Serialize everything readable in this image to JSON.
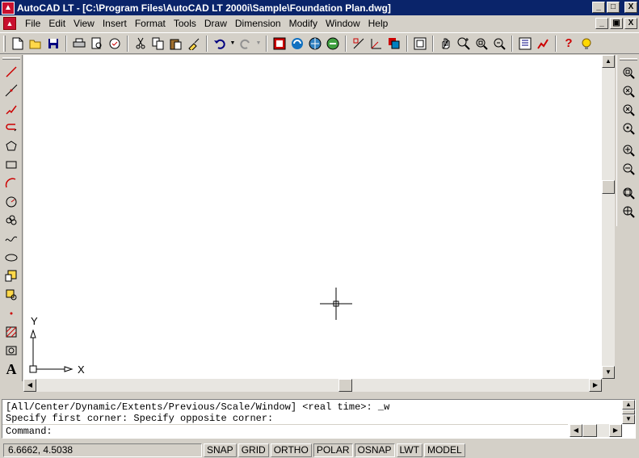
{
  "window": {
    "title": "AutoCAD LT - [C:\\Program Files\\AutoCAD LT 2000i\\Sample\\Foundation Plan.dwg]",
    "controls": [
      "_",
      "□",
      "X"
    ]
  },
  "menubar": {
    "items": [
      "File",
      "Edit",
      "View",
      "Insert",
      "Format",
      "Tools",
      "Draw",
      "Dimension",
      "Modify",
      "Window",
      "Help"
    ],
    "doc_controls": [
      "_",
      "▣",
      "X"
    ]
  },
  "toolbar": {
    "icons": [
      "new-icon",
      "open-icon",
      "save-icon",
      "print-icon",
      "print-preview-icon",
      "spell-check-icon",
      "cut-icon",
      "copy-icon",
      "paste-icon",
      "match-properties-icon",
      "undo-icon",
      "redo-icon",
      "designcenter-icon",
      "web-icon",
      "publish-icon",
      "hyperlink-icon",
      "snap-from-icon",
      "ucs-icon",
      "display-order-icon",
      "aerial-view-icon",
      "pan-icon",
      "zoom-realtime-icon",
      "zoom-window-icon",
      "zoom-previous-icon",
      "properties-icon",
      "designcenter2-icon",
      "help-icon",
      "tips-icon"
    ]
  },
  "draw_toolbar": {
    "tools": [
      "line",
      "construction-line",
      "polyline",
      "polyline-undo",
      "polygon",
      "rectangle",
      "arc",
      "circle",
      "revision-cloud",
      "spline",
      "ellipse",
      "insert-block",
      "make-block",
      "point",
      "hatch",
      "region",
      "text"
    ],
    "text_glyph": "A"
  },
  "zoom_toolbar": {
    "tools": [
      "zoom-window",
      "zoom-dynamic",
      "zoom-scale",
      "zoom-center",
      "zoom-in",
      "zoom-out",
      "zoom-all",
      "zoom-extents"
    ]
  },
  "ucs": {
    "x_label": "X",
    "y_label": "Y"
  },
  "command_window": {
    "line1": "[All/Center/Dynamic/Extents/Previous/Scale/Window] <real time>: _w",
    "line2": "Specify first corner: Specify opposite corner:",
    "prompt": "Command:"
  },
  "status_bar": {
    "coordinates": "6.6662, 4.5038",
    "toggles": [
      {
        "label": "SNAP",
        "on": false
      },
      {
        "label": "GRID",
        "on": false
      },
      {
        "label": "ORTHO",
        "on": false
      },
      {
        "label": "POLAR",
        "on": true
      },
      {
        "label": "OSNAP",
        "on": true
      },
      {
        "label": "LWT",
        "on": false
      },
      {
        "label": "MODEL",
        "on": false
      }
    ]
  }
}
